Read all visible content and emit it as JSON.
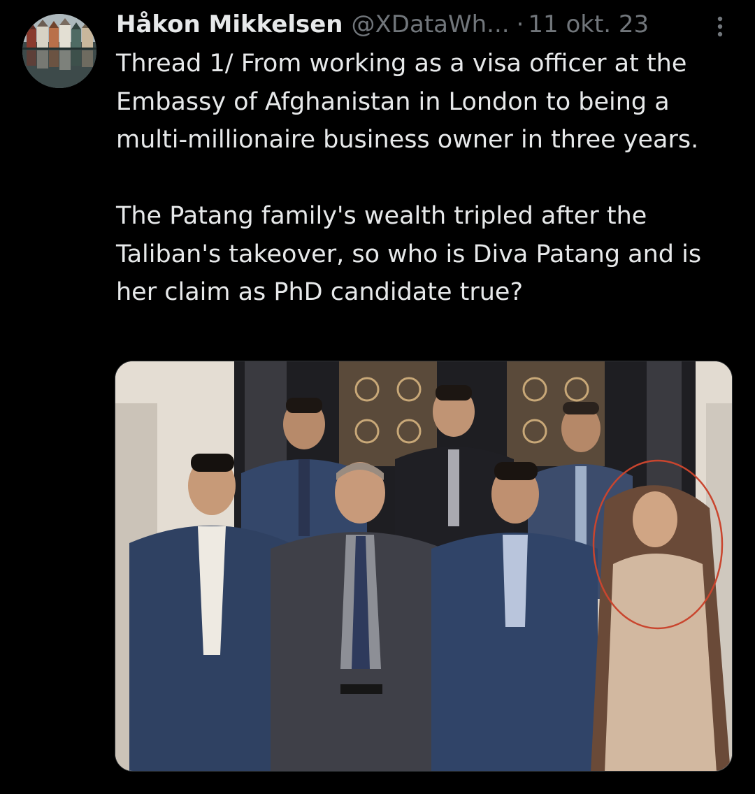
{
  "tweet": {
    "author_name": "Håkon Mikkelsen",
    "author_handle": "@XDataWh...",
    "separator": "·",
    "timestamp": "11 okt. 23",
    "text": "Thread 1/ From working as a visa officer at the Embassy of Afghanistan in London to being a multi-millionaire business owner in three years.\n\nThe Patang family's wealth tripled after the Taliban's takeover, so who is Diva Patang and is her claim as PhD candidate true?",
    "more_icon": "more-vertical-icon",
    "avatar_icon": "profile-photo-harbor-houses",
    "media": {
      "kind": "photo",
      "icon": "group-photo",
      "highlight_color": "#c9452e"
    }
  },
  "colors": {
    "background": "#000000",
    "text_primary": "#e7e9ea",
    "text_secondary": "#71767b"
  }
}
